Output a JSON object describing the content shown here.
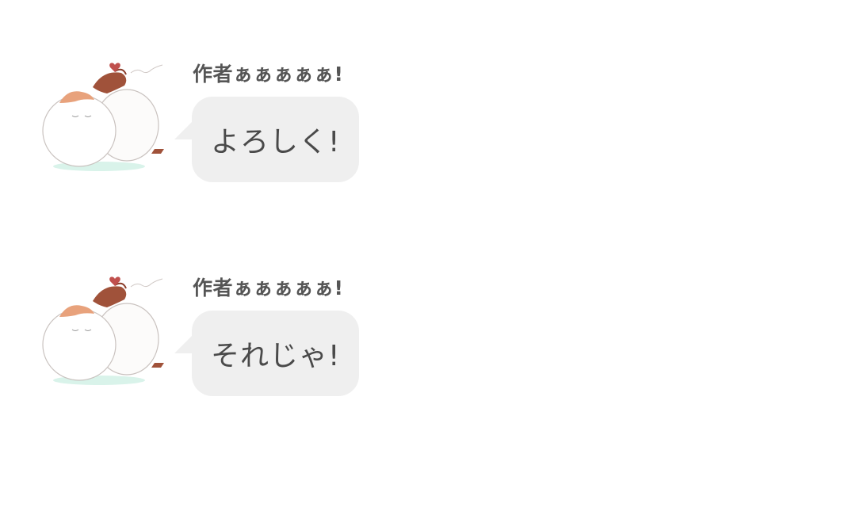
{
  "messages": [
    {
      "sender": "作者ぁぁぁぁぁ!",
      "text": "よろしく!",
      "avatar_icon": "fluffy-birds-avatar-icon"
    },
    {
      "sender": "作者ぁぁぁぁぁ!",
      "text": "それじゃ!",
      "avatar_icon": "fluffy-birds-avatar-icon"
    }
  ],
  "colors": {
    "background": "#ffffff",
    "bubble": "#efefef",
    "name_text": "#555555",
    "message_text": "#4a4a4a",
    "heart": "#c0504d",
    "hair": "#a0523a"
  }
}
